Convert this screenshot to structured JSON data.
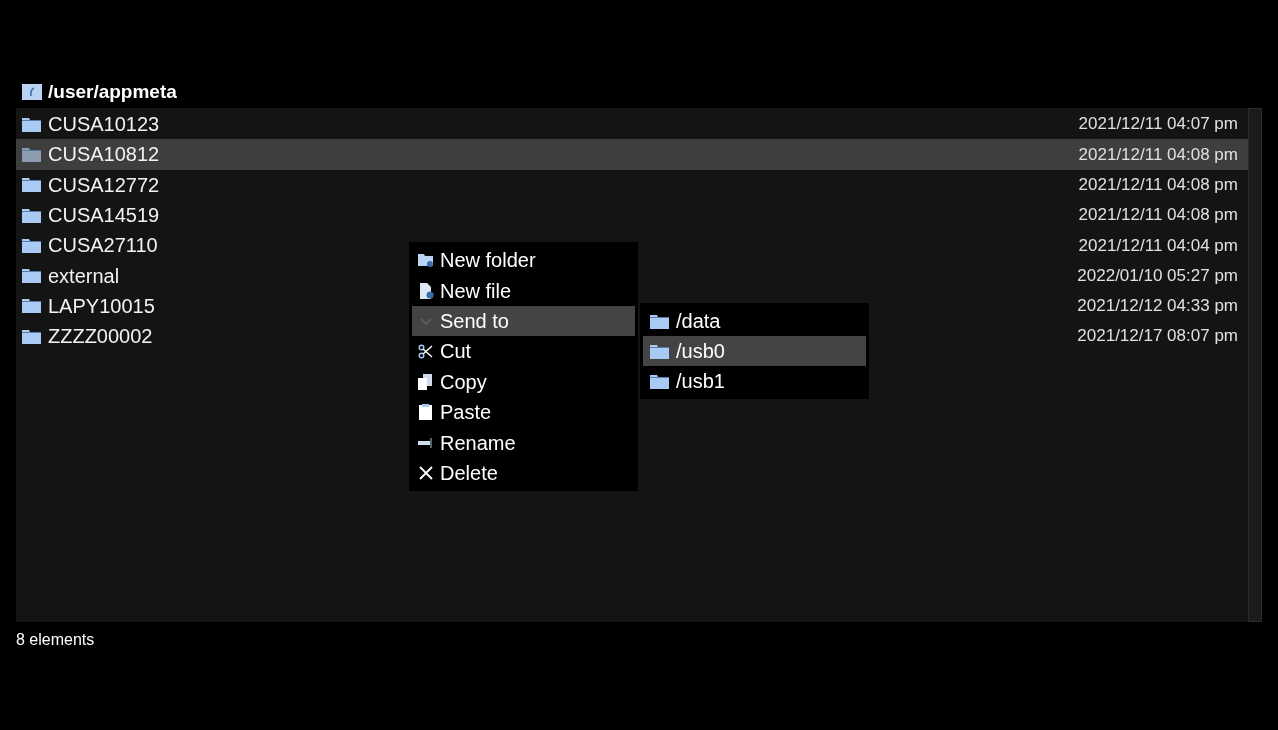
{
  "path": "/user/appmeta",
  "rows": [
    {
      "name": "CUSA10123",
      "date": "2021/12/11 04:07 pm",
      "selected": false
    },
    {
      "name": "CUSA10812",
      "date": "2021/12/11 04:08 pm",
      "selected": true
    },
    {
      "name": "CUSA12772",
      "date": "2021/12/11 04:08 pm",
      "selected": false
    },
    {
      "name": "CUSA14519",
      "date": "2021/12/11 04:08 pm",
      "selected": false
    },
    {
      "name": "CUSA27110",
      "date": "2021/12/11 04:04 pm",
      "selected": false
    },
    {
      "name": "external",
      "date": "2022/01/10 05:27 pm",
      "selected": false
    },
    {
      "name": "LAPY10015",
      "date": "2021/12/12 04:33 pm",
      "selected": false
    },
    {
      "name": "ZZZZ00002",
      "date": "2021/12/17 08:07 pm",
      "selected": false
    }
  ],
  "context_menu": [
    {
      "label": "New folder",
      "kind": "folder",
      "selected": false
    },
    {
      "label": "New file",
      "kind": "file",
      "selected": false
    },
    {
      "label": "Send to",
      "kind": "submenu",
      "selected": true
    },
    {
      "label": "Cut",
      "kind": "cut",
      "selected": false
    },
    {
      "label": "Copy",
      "kind": "copy",
      "selected": false
    },
    {
      "label": "Paste",
      "kind": "paste",
      "selected": false
    },
    {
      "label": "Rename",
      "kind": "rename",
      "selected": false
    },
    {
      "label": "Delete",
      "kind": "delete",
      "selected": false
    }
  ],
  "submenu": [
    {
      "label": "/data",
      "selected": false
    },
    {
      "label": "/usb0",
      "selected": true
    },
    {
      "label": "/usb1",
      "selected": false
    }
  ],
  "status_bar": "8 elements"
}
